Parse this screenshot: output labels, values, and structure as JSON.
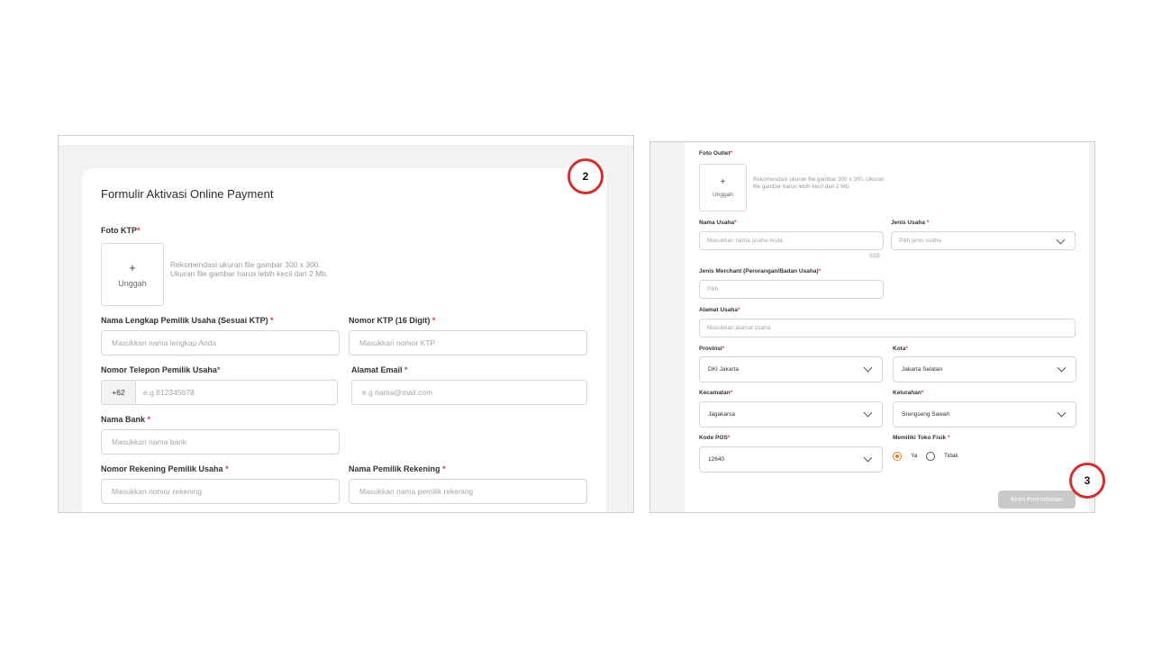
{
  "left": {
    "title": "Formulir Aktivasi Online Payment",
    "foto_ktp_label": "Foto KTP",
    "upload_plus": "+",
    "upload_label": "Unggah",
    "upload_hint": "Rekomendasi ukuran file gambar 300 x 300. Ukuran file gambar harus lebih kecil dari 2 Mb.",
    "required_mark": "*",
    "nama_lengkap_label": "Nama Lengkap Pemilik Usaha (Sesuai KTP)",
    "nama_lengkap_placeholder": "Masukkan nama lengkap Anda",
    "nomor_ktp_label": "Nomor KTP (16 Digit)",
    "nomor_ktp_placeholder": "Masukkan nomor KTP",
    "telepon_label": "Nomor Telepon Pemilik Usaha",
    "telepon_prefix": "+62",
    "telepon_placeholder": "e.g 812345678",
    "email_label": "Alamat Email",
    "email_placeholder": "e.g nama@mail.com",
    "bank_label": "Nama Bank",
    "bank_placeholder": "Masukkan nama bank",
    "rekening_label": "Nomor Rekening Pemilik Usaha",
    "rekening_placeholder": "Masukkan nomor rekening",
    "pemilik_rekening_label": "Nama Pemilik Rekening",
    "pemilik_rekening_placeholder": "Masukkan nama pemilik rekening"
  },
  "right": {
    "foto_outlet_label": "Foto Outlet",
    "upload_plus": "+",
    "upload_label": "Unggah",
    "upload_hint": "Rekomendasi ukuran file gambar 300 x 300. Ukuran file gambar harus lebih kecil dari 2 Mb.",
    "required_mark": "*",
    "nama_usaha_label": "Nama Usaha",
    "nama_usaha_placeholder": "Masukkan nama usaha Anda",
    "nama_usaha_counter": "0/25",
    "jenis_usaha_label": "Jenis Usaha",
    "jenis_usaha_placeholder": "Pilih jenis usaha",
    "jenis_merchant_label": "Jenis Merchant (Perorangan/Badan Usaha)",
    "jenis_merchant_placeholder": "Pilih",
    "alamat_label": "Alamat Usaha",
    "alamat_placeholder": "Masukkan alamat usaha",
    "provinsi_label": "Provinsi",
    "provinsi_value": "DKI Jakarta",
    "kota_label": "Kota",
    "kota_value": "Jakarta Selatan",
    "kecamatan_label": "Kecamatan",
    "kecamatan_value": "Jagakarsa",
    "kelurahan_label": "Kelurahan",
    "kelurahan_value": "Srengseng Sawah",
    "kode_pos_label": "Kode POS",
    "kode_pos_value": "12640",
    "toko_fisik_label": "Memiliki Toko Fisik",
    "option_ya": "Ya",
    "option_tidak": "Tidak",
    "submit_label": "Kirim Permohonan"
  },
  "badges": {
    "step2": "2",
    "step3": "3"
  },
  "colors": {
    "required": "#e53935",
    "accent": "#f07c1e",
    "badge_ring": "#d32f2f",
    "disabled_button": "#c9c9c9"
  }
}
